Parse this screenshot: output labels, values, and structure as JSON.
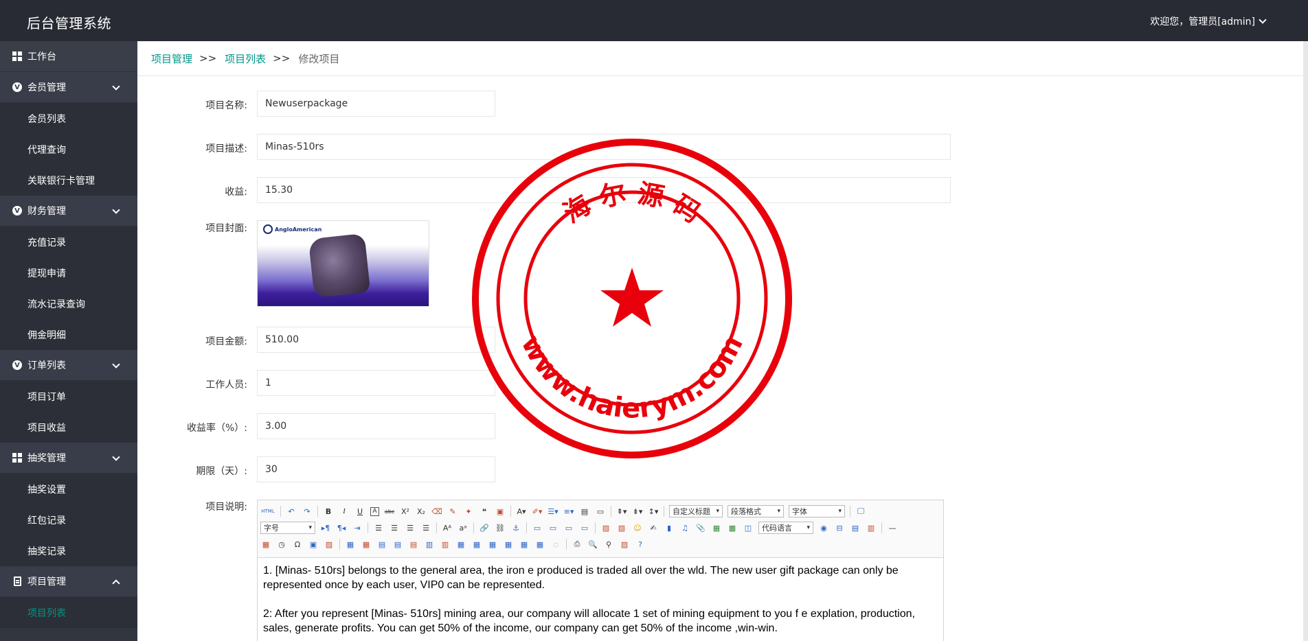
{
  "header": {
    "brand": "后台管理系统",
    "user_greeting": "欢迎您，管理员[admin]"
  },
  "sidebar": {
    "dashboard": "工作台",
    "groups": [
      {
        "label": "会员管理",
        "items": [
          "会员列表",
          "代理查询",
          "关联银行卡管理"
        ]
      },
      {
        "label": "财务管理",
        "items": [
          "充值记录",
          "提现申请",
          "流水记录查询",
          "佣金明细"
        ]
      },
      {
        "label": "订单列表",
        "items": [
          "项目订单",
          "项目收益"
        ]
      },
      {
        "label": "抽奖管理",
        "items": [
          "抽奖设置",
          "红包记录",
          "抽奖记录"
        ]
      },
      {
        "label": "项目管理",
        "items": [
          "项目列表"
        ]
      }
    ]
  },
  "breadcrumb": {
    "level1": "项目管理",
    "level2": "项目列表",
    "current": "修改项目",
    "separator": ">>"
  },
  "form": {
    "name_label": "项目名称:",
    "name_value": "Newuserpackage",
    "desc_label": "项目描述:",
    "desc_value": "Minas-510rs",
    "income_label": "收益:",
    "income_value": "15.30",
    "cover_label": "项目封面:",
    "cover_logo_text": "AngloAmerican",
    "amount_label": "项目金额:",
    "amount_value": "510.00",
    "workers_label": "工作人员:",
    "workers_value": "1",
    "rate_label": "收益率（%）:",
    "rate_value": "3.00",
    "period_label": "期限（天）:",
    "period_value": "30",
    "explain_label": "项目说明:"
  },
  "editor": {
    "toolbar": {
      "custom_title": "自定义标题",
      "paragraph_format": "段落格式",
      "font_family": "字体",
      "font_size": "字号",
      "code_language": "代码语言"
    },
    "paragraphs": [
      "1. [Minas- 510rs] belongs to the general area,  the iron e produced is traded all over the wld. The new user gift package can only be represented once by each user,  VIP0 can be represented.",
      "2: After you represent [Minas- 510rs] mining area, our company will allocate 1 set of mining equipment to you f e explation, production, sales,  generate profits. You can get 50% of the income,  our company can get 50% of the income ,win-win."
    ]
  },
  "watermark": {
    "top_text": "海 尔 源 码",
    "bottom_text": "www.haierym.com",
    "color": "#e8000b"
  }
}
